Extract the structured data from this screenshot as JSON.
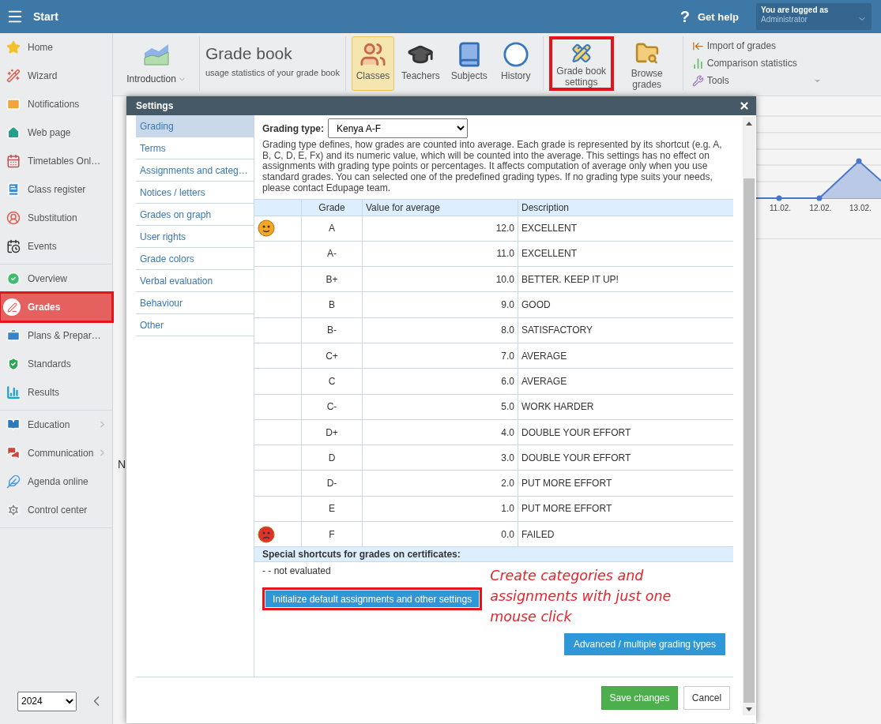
{
  "top_bar": {
    "menu_label": "Start",
    "help_mark": "?",
    "help_label": "Get help",
    "login_caption": "You are logged as",
    "login_user": "Administrator"
  },
  "sidebar": {
    "groups": [
      {
        "items": [
          {
            "label": "Home",
            "selected": false,
            "highlighted": false,
            "submenu": false
          },
          {
            "label": "Wizard",
            "selected": false,
            "highlighted": false,
            "submenu": false
          },
          {
            "label": "Notifications",
            "selected": false,
            "highlighted": false,
            "submenu": false
          },
          {
            "label": "Web page",
            "selected": false,
            "highlighted": false,
            "submenu": false
          },
          {
            "label": "Timetables Onl…",
            "selected": false,
            "highlighted": false,
            "submenu": false
          },
          {
            "label": "Class register",
            "selected": false,
            "highlighted": false,
            "submenu": false
          },
          {
            "label": "Substitution",
            "selected": false,
            "highlighted": false,
            "submenu": false
          },
          {
            "label": "Events",
            "selected": false,
            "highlighted": false,
            "submenu": false
          }
        ]
      },
      {
        "items": [
          {
            "label": "Overview",
            "selected": false,
            "highlighted": false,
            "submenu": false
          },
          {
            "label": "Grades",
            "selected": true,
            "highlighted": true,
            "submenu": false
          },
          {
            "label": "Plans & Prepar…",
            "selected": false,
            "highlighted": false,
            "submenu": false
          },
          {
            "label": "Standards",
            "selected": false,
            "highlighted": false,
            "submenu": false
          },
          {
            "label": "Results",
            "selected": false,
            "highlighted": false,
            "submenu": false
          }
        ]
      },
      {
        "items": [
          {
            "label": "Education",
            "selected": false,
            "highlighted": false,
            "submenu": true
          },
          {
            "label": "Communication",
            "selected": false,
            "highlighted": false,
            "submenu": true
          },
          {
            "label": "Agenda online",
            "selected": false,
            "highlighted": false,
            "submenu": false
          },
          {
            "label": "Control center",
            "selected": false,
            "highlighted": false,
            "submenu": false
          }
        ]
      }
    ],
    "year": "2024"
  },
  "toolbar": {
    "intro_label": "Introduction",
    "title": "Grade book",
    "subtitle": "usage statistics of your grade book",
    "button_groups": [
      {
        "buttons": [
          {
            "label": "Classes",
            "selected": true,
            "highlighted": false
          },
          {
            "label": "Teachers",
            "selected": false,
            "highlighted": false
          },
          {
            "label": "Subjects",
            "selected": false,
            "highlighted": false
          },
          {
            "label": "History",
            "selected": false,
            "highlighted": false
          }
        ]
      },
      {
        "buttons": [
          {
            "label": "Grade book settings",
            "selected": false,
            "highlighted": true
          },
          {
            "label": "Browse grades",
            "selected": false,
            "highlighted": false
          }
        ]
      }
    ],
    "links": [
      {
        "label": "Import of grades",
        "dropdown": false
      },
      {
        "label": "Comparison statistics",
        "dropdown": false
      },
      {
        "label": "Tools",
        "dropdown": true
      }
    ]
  },
  "background": {
    "chart_labels": [
      "11.02.",
      "12.02.",
      "13.02."
    ],
    "cut_text": "N"
  },
  "dialog": {
    "title": "Settings",
    "nav": [
      {
        "label": "Grading",
        "selected": true
      },
      {
        "label": "Terms",
        "selected": false
      },
      {
        "label": "Assignments and categ…",
        "selected": false
      },
      {
        "label": "Notices / letters",
        "selected": false
      },
      {
        "label": "Grades on graph",
        "selected": false
      },
      {
        "label": "User rights",
        "selected": false
      },
      {
        "label": "Grade colors",
        "selected": false
      },
      {
        "label": "Verbal evaluation",
        "selected": false
      },
      {
        "label": "Behaviour",
        "selected": false
      },
      {
        "label": "Other",
        "selected": false
      }
    ],
    "grading_type_label": "Grading type:",
    "grading_type_value": "Kenya A-F",
    "description": "Grading type defines, how grades are counted into average. Each grade is represented by its shortcut (e.g. A, B, C, D, E, Fx) and its numeric value, which will be counted into the average. This settings has no effect on assignments with grading type points or percentages. It affects computation of average only when you use standard grades. You can selected one of the predefined grading types. If no grading type suits your needs, please contact Edupage team.",
    "table": {
      "columns": [
        "Grade",
        "Value for average",
        "Description"
      ],
      "rows": [
        {
          "kind": "top",
          "grade": "A",
          "value": "12.0",
          "description": "EXCELLENT"
        },
        {
          "kind": "plain",
          "grade": "A-",
          "value": "11.0",
          "description": "EXCELLENT"
        },
        {
          "kind": "plain",
          "grade": "B+",
          "value": "10.0",
          "description": "BETTER. KEEP IT UP!"
        },
        {
          "kind": "plain",
          "grade": "B",
          "value": "9.0",
          "description": "GOOD"
        },
        {
          "kind": "plain",
          "grade": "B-",
          "value": "8.0",
          "description": "SATISFACTORY"
        },
        {
          "kind": "plain",
          "grade": "C+",
          "value": "7.0",
          "description": "AVERAGE"
        },
        {
          "kind": "plain",
          "grade": "C",
          "value": "6.0",
          "description": "AVERAGE"
        },
        {
          "kind": "plain",
          "grade": "C-",
          "value": "5.0",
          "description": "WORK HARDER"
        },
        {
          "kind": "plain",
          "grade": "D+",
          "value": "4.0",
          "description": "DOUBLE YOUR EFFORT"
        },
        {
          "kind": "plain",
          "grade": "D",
          "value": "3.0",
          "description": "DOUBLE YOUR EFFORT"
        },
        {
          "kind": "plain",
          "grade": "D-",
          "value": "2.0",
          "description": "PUT MORE EFFORT"
        },
        {
          "kind": "plain",
          "grade": "E",
          "value": "1.0",
          "description": "PUT MORE EFFORT"
        },
        {
          "kind": "fail",
          "grade": "F",
          "value": "0.0",
          "description": "FAILED"
        }
      ]
    },
    "special_heading": "Special shortcuts for grades on certificates:",
    "special_items": [
      "- - not evaluated"
    ],
    "init_button": {
      "label": "Initialize default assignments and other settings",
      "highlighted": true
    },
    "annotation": "Create categories and assignments with just one mouse click",
    "advanced_button": "Advanced / multiple grading types",
    "save_button": "Save changes",
    "cancel_button": "Cancel"
  }
}
